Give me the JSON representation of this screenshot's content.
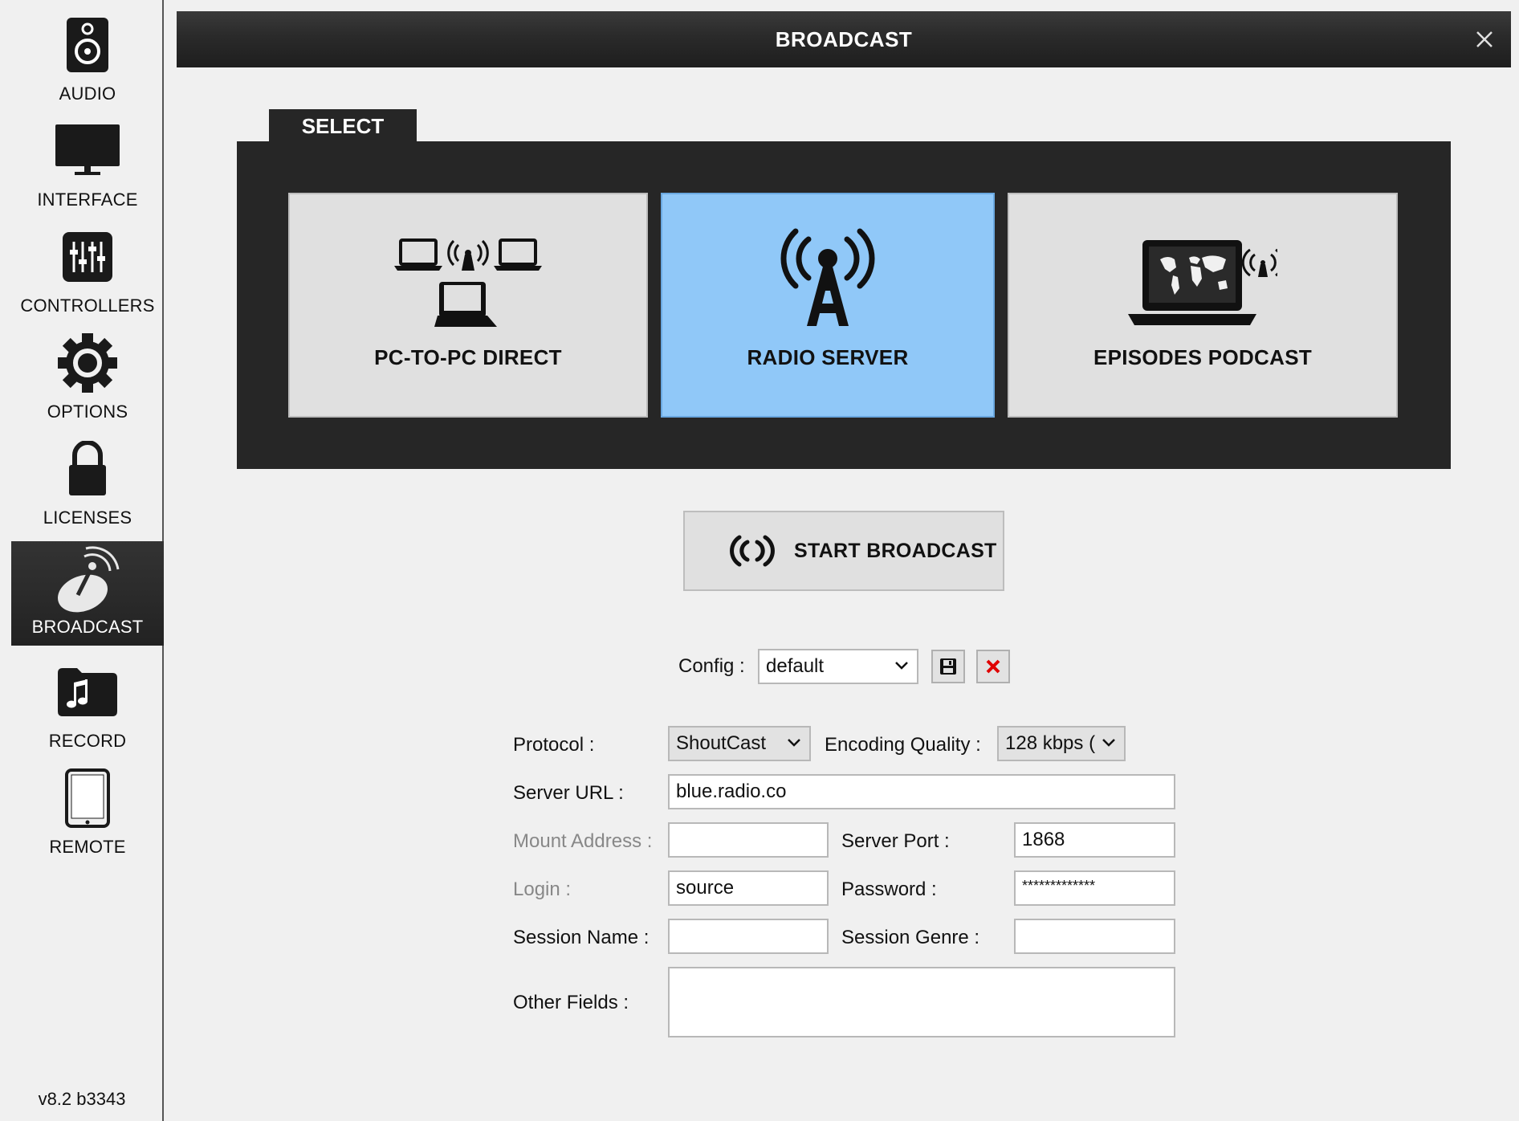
{
  "sidebar": {
    "items": [
      {
        "label": "AUDIO",
        "icon": "speaker-icon"
      },
      {
        "label": "INTERFACE",
        "icon": "monitor-icon"
      },
      {
        "label": "CONTROLLERS",
        "icon": "sliders-icon"
      },
      {
        "label": "OPTIONS",
        "icon": "gear-icon"
      },
      {
        "label": "LICENSES",
        "icon": "lock-icon"
      },
      {
        "label": "BROADCAST",
        "icon": "satellite-dish-icon"
      },
      {
        "label": "RECORD",
        "icon": "music-folder-icon"
      },
      {
        "label": "REMOTE",
        "icon": "tablet-icon"
      }
    ],
    "active": "BROADCAST",
    "version": "v8.2 b3343"
  },
  "window": {
    "title": "BROADCAST"
  },
  "select": {
    "tab_label": "SELECT",
    "options": [
      {
        "label": "PC-TO-PC DIRECT",
        "icon": "pc-network-icon",
        "selected": false
      },
      {
        "label": "RADIO SERVER",
        "icon": "radio-tower-icon",
        "selected": true
      },
      {
        "label": "EPISODES PODCAST",
        "icon": "laptop-world-icon",
        "selected": false
      }
    ]
  },
  "start_broadcast": {
    "label": "START BROADCAST"
  },
  "config": {
    "label": "Config :",
    "value": "default"
  },
  "form": {
    "protocol": {
      "label": "Protocol :",
      "value": "ShoutCast"
    },
    "encoding_quality": {
      "label": "Encoding Quality :",
      "value": "128 kbps ("
    },
    "server_url": {
      "label": "Server URL :",
      "value": "blue.radio.co"
    },
    "mount_address": {
      "label": "Mount Address :",
      "value": ""
    },
    "server_port": {
      "label": "Server Port :",
      "value": "1868"
    },
    "login": {
      "label": "Login :",
      "value": "source"
    },
    "password": {
      "label": "Password :",
      "value": "*************"
    },
    "session_name": {
      "label": "Session Name :",
      "value": ""
    },
    "session_genre": {
      "label": "Session Genre :",
      "value": ""
    },
    "other_fields": {
      "label": "Other Fields :",
      "value": ""
    }
  },
  "colors": {
    "selected_card": "#90c8f8",
    "dark_panel": "#262626",
    "delete_red": "#e00000"
  }
}
